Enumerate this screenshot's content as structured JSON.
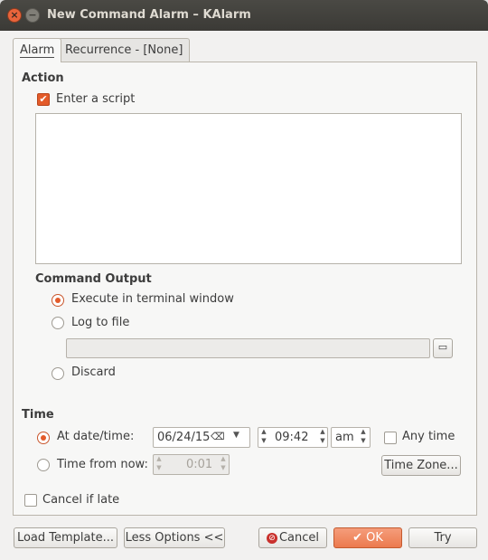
{
  "window": {
    "title": "New Command Alarm – KAlarm",
    "close_glyph": "×",
    "minimize_glyph": "−"
  },
  "tabs": [
    {
      "label": "Alarm"
    },
    {
      "label": "Recurrence - [None]"
    }
  ],
  "action": {
    "heading": "Action",
    "enter_script_label": "Enter a script",
    "enter_script_checked": true,
    "script_text": ""
  },
  "command_output": {
    "heading": "Command Output",
    "options": [
      {
        "label": "Execute in terminal window",
        "selected": true
      },
      {
        "label": "Log to file",
        "selected": false
      },
      {
        "label": "Discard",
        "selected": false
      }
    ],
    "log_file_path": ""
  },
  "time": {
    "heading": "Time",
    "at_date_time_label": "At date/time:",
    "at_date_time_selected": true,
    "date_value": "06/24/15",
    "time_value": "09:42",
    "ampm_value": "am",
    "any_time_label": "Any time",
    "any_time_checked": false,
    "time_from_now_label": "Time from now:",
    "time_from_now_value": "0:01",
    "time_zone_button": "Time Zone...",
    "cancel_if_late_label": "Cancel if late",
    "cancel_if_late_checked": false
  },
  "buttons": {
    "load_template": "Load Template...",
    "less_options": "Less Options <<",
    "cancel": "Cancel",
    "ok": "OK",
    "try": "Try"
  },
  "colors": {
    "accent": "#e35b2a",
    "titlebar": "#3b3a36",
    "ok_button": "#ec7a4e"
  },
  "icons": [
    "close-icon",
    "minimize-icon",
    "checkbox-checked-icon",
    "clear-text-icon",
    "dropdown-arrow-icon",
    "spin-up-icon",
    "spin-down-icon",
    "folder-browse-icon",
    "cancel-icon",
    "ok-check-icon"
  ]
}
